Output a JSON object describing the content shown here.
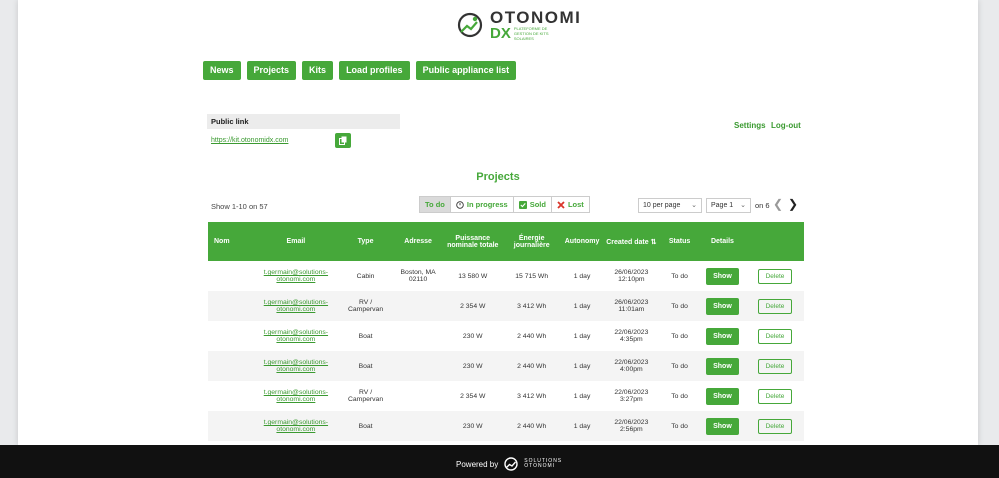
{
  "brand": {
    "name": "OTONOMI",
    "dx": "DX",
    "subtitle": "PLATEFORME DE GESTION DE KITS SOLAIRES"
  },
  "nav": [
    "News",
    "Projects",
    "Kits",
    "Load profiles",
    "Public appliance list"
  ],
  "public_link": {
    "label": "Public link",
    "url": "https://kit.otonomidx.com"
  },
  "user_links": {
    "settings": "Settings",
    "logout": "Log-out"
  },
  "section_title": "Projects",
  "show_count": "Show 1-10 on 57",
  "filters": [
    "To do",
    "In progress",
    "Sold",
    "Lost"
  ],
  "pagination": {
    "per_page": "10 per page",
    "page": "Page 1",
    "on": "on 6"
  },
  "columns": [
    "Nom",
    "Email",
    "Type",
    "Adresse",
    "Puissance nominale totale",
    "Énergie journalière",
    "Autonomy",
    "Created date",
    "Status",
    "Details",
    ""
  ],
  "rows": [
    {
      "nom": "",
      "email": "t.germain@solutions-otonomi.com",
      "type": "Cabin",
      "adresse": "Boston, MA 02110",
      "puissance": "13 580 W",
      "energie": "15 715 Wh",
      "autonomy": "1 day",
      "date": "26/06/2023 12:10pm",
      "status": "To do",
      "show": "Show",
      "delete": "Delete"
    },
    {
      "nom": "",
      "email": "t.germain@solutions-otonomi.com",
      "type": "RV / Campervan",
      "adresse": "",
      "puissance": "2 354 W",
      "energie": "3 412 Wh",
      "autonomy": "1 day",
      "date": "26/06/2023 11:01am",
      "status": "To do",
      "show": "Show",
      "delete": "Delete"
    },
    {
      "nom": "",
      "email": "t.germain@solutions-otonomi.com",
      "type": "Boat",
      "adresse": "",
      "puissance": "230 W",
      "energie": "2 440 Wh",
      "autonomy": "1 day",
      "date": "22/06/2023 4:35pm",
      "status": "To do",
      "show": "Show",
      "delete": "Delete"
    },
    {
      "nom": "",
      "email": "t.germain@solutions-otonomi.com",
      "type": "Boat",
      "adresse": "",
      "puissance": "230 W",
      "energie": "2 440 Wh",
      "autonomy": "1 day",
      "date": "22/06/2023 4:00pm",
      "status": "To do",
      "show": "Show",
      "delete": "Delete"
    },
    {
      "nom": "",
      "email": "t.germain@solutions-otonomi.com",
      "type": "RV / Campervan",
      "adresse": "",
      "puissance": "2 354 W",
      "energie": "3 412 Wh",
      "autonomy": "1 day",
      "date": "22/06/2023 3:27pm",
      "status": "To do",
      "show": "Show",
      "delete": "Delete"
    },
    {
      "nom": "",
      "email": "t.germain@solutions-otonomi.com",
      "type": "Boat",
      "adresse": "",
      "puissance": "230 W",
      "energie": "2 440 Wh",
      "autonomy": "1 day",
      "date": "22/06/2023 2:56pm",
      "status": "To do",
      "show": "Show",
      "delete": "Delete"
    }
  ],
  "footer": {
    "powered_by": "Powered by",
    "logo_line1": "SOLUTIONS",
    "logo_line2": "OTONOMI"
  },
  "colors": {
    "accent": "#46a83a",
    "lost": "#d9362b",
    "footer_bg": "#111111"
  }
}
